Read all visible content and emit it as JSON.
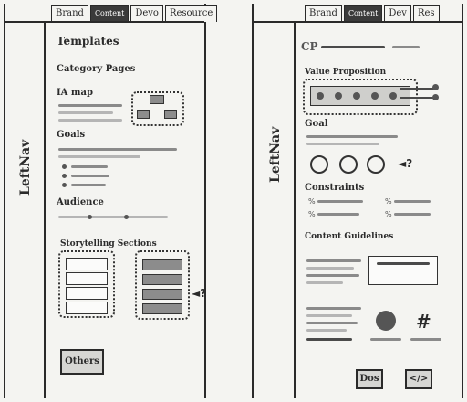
{
  "left_screen": {
    "tabs": [
      "Brand",
      "Content",
      "Devo",
      "Resource"
    ],
    "active_tab": 1,
    "nav_label": "LeftNav",
    "title": "Templates",
    "subtitle": "Category Pages",
    "ia_map_label": "IA map",
    "goals_label": "Goals",
    "audience_label": "Audience",
    "storytelling_label": "Storytelling Sections",
    "others_button": "Others",
    "callout_mark": "◄?"
  },
  "right_screen": {
    "tabs": [
      "Brand",
      "Content",
      "Dev",
      "Res"
    ],
    "active_tab": 1,
    "nav_label": "LeftNav",
    "breadcrumb": "CP",
    "value_prop_label": "Value Proposition",
    "goal_label": "Goal",
    "goal_mark": "◄?",
    "constraints_label": "Constraints",
    "constraint_symbols": [
      "%",
      "%",
      "%",
      "%",
      "%",
      "%"
    ],
    "content_guidelines_label": "Content Guidelines",
    "hash_symbol": "#",
    "docs_button": "Dos",
    "code_button": "</>"
  },
  "colors": {
    "ink": "#2a2a2a",
    "marker_grey": "#8a8a8a",
    "paper": "#f4f4f1"
  }
}
